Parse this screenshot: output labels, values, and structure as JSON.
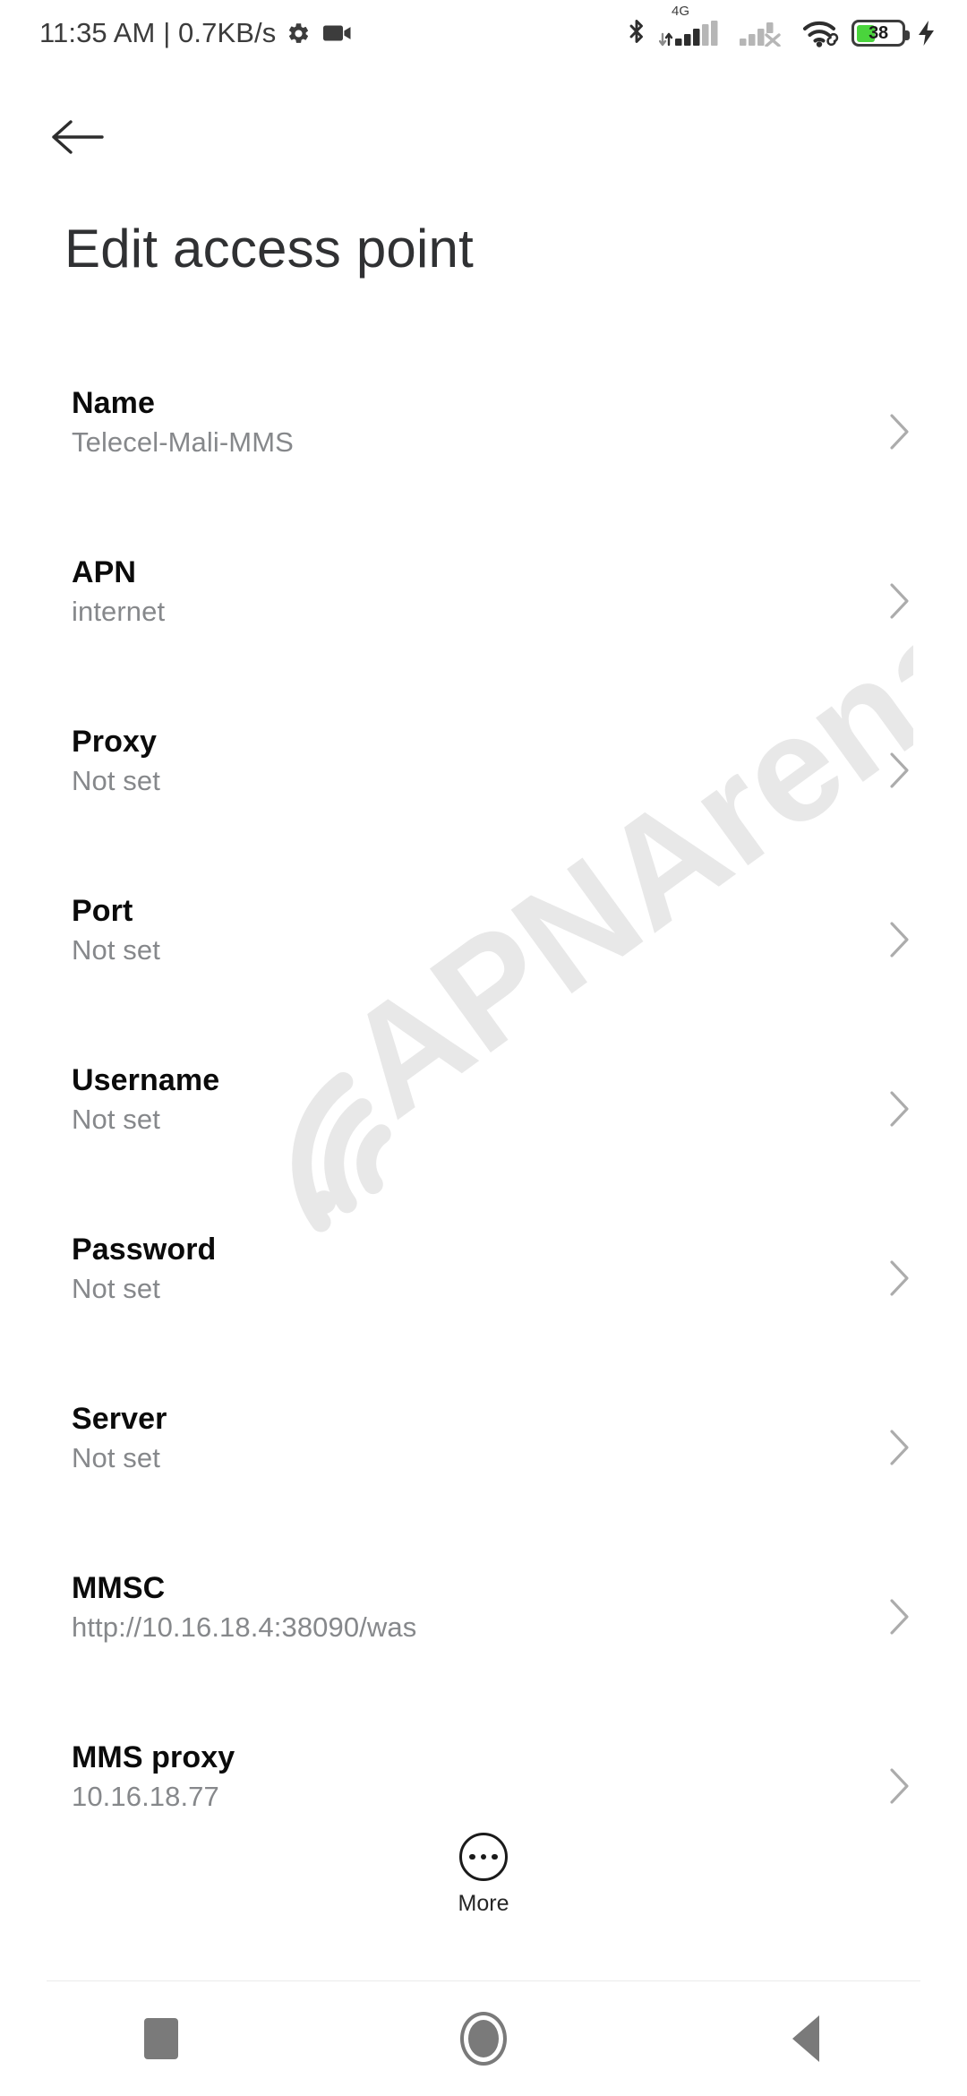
{
  "status_bar": {
    "clock": "11:35 AM | 0.7KB/s",
    "network_type": "4G",
    "battery_percent": "38",
    "battery_level_pct": 42,
    "colors": {
      "battery_fill": "#4ad43c",
      "icon": "#3c3c3c"
    }
  },
  "header": {
    "title": "Edit access point",
    "back_label": "Back"
  },
  "watermark": {
    "text": "APNArena"
  },
  "settings": {
    "rows": [
      {
        "title": "Name",
        "value": "Telecel-Mali-MMS"
      },
      {
        "title": "APN",
        "value": "internet"
      },
      {
        "title": "Proxy",
        "value": "Not set"
      },
      {
        "title": "Port",
        "value": "Not set"
      },
      {
        "title": "Username",
        "value": "Not set"
      },
      {
        "title": "Password",
        "value": "Not set"
      },
      {
        "title": "Server",
        "value": "Not set"
      },
      {
        "title": "MMSC",
        "value": "http://10.16.18.4:38090/was"
      },
      {
        "title": "MMS proxy",
        "value": "10.16.18.77"
      }
    ]
  },
  "more_button": {
    "label": "More"
  },
  "navbar": {
    "recents_label": "Recents",
    "home_label": "Home",
    "back_label": "Back"
  }
}
